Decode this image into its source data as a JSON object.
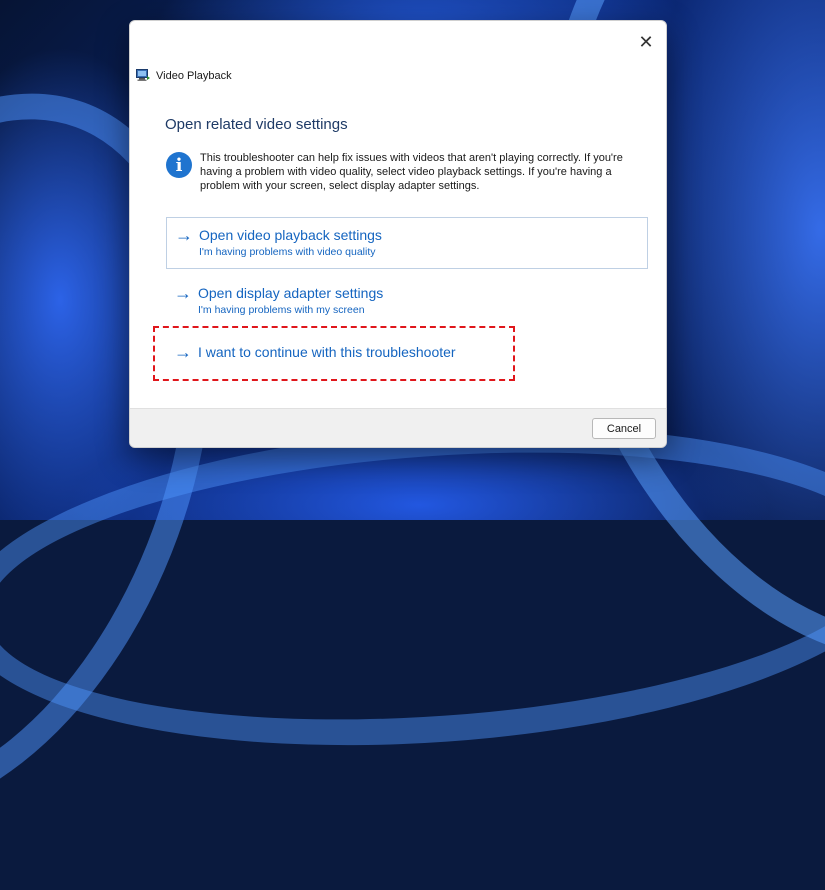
{
  "window": {
    "title": "Video Playback",
    "title_icon": "video-playback-icon",
    "close_glyph": "✕"
  },
  "content": {
    "heading": "Open related video settings",
    "info_icon": "info-icon",
    "info_glyph": "i",
    "info_text": "This troubleshooter can help fix issues with videos that aren't playing correctly. If you're having a problem with video quality, select video playback settings. If you're having a problem with your screen, select display adapter settings."
  },
  "options": [
    {
      "arrow": "→",
      "title": "Open video playback settings",
      "subtitle": "I'm having problems with video quality"
    },
    {
      "arrow": "→",
      "title": "Open display adapter settings",
      "subtitle": "I'm having problems with my screen"
    },
    {
      "arrow": "→",
      "title": "I want to continue with this troubleshooter",
      "subtitle": ""
    }
  ],
  "footer": {
    "cancel_label": "Cancel"
  },
  "colors": {
    "link": "#1565c0",
    "heading": "#1e3a66",
    "highlight": "#e0161b",
    "info_icon": "#1f74cf"
  }
}
